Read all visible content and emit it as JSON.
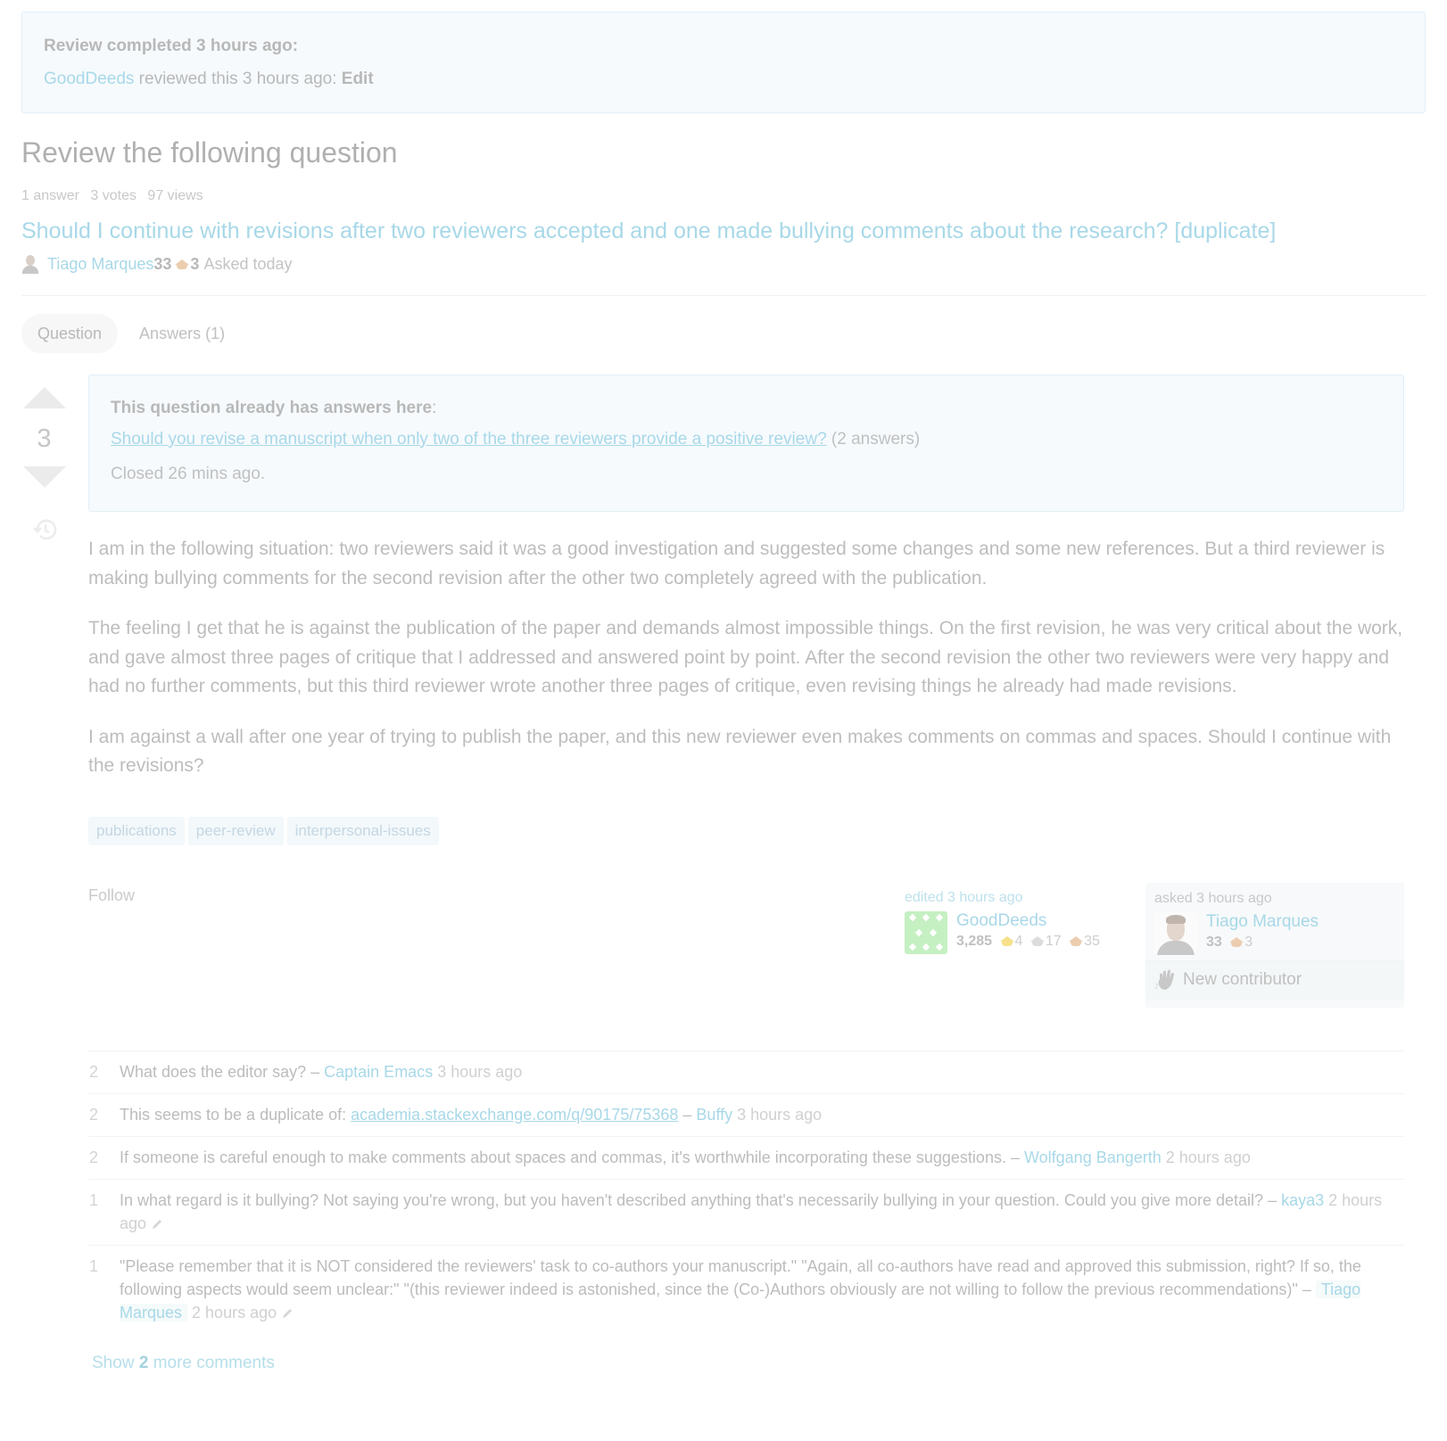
{
  "review_notice": {
    "title": "Review completed 3 hours ago:",
    "reviewer": "GoodDeeds",
    "reviewed_text": " reviewed this 3 hours ago: ",
    "action": "Edit"
  },
  "page_title": "Review the following question",
  "stats": {
    "answers": "1 answer",
    "votes": "3 votes",
    "views": "97 views"
  },
  "question": {
    "title": "Should I continue with revisions after two reviewers accepted and one made bullying comments about the research? [duplicate]",
    "asker": {
      "name": "Tiago Marques",
      "reputation": "33",
      "bronze_badges": "3",
      "asked": "Asked today"
    }
  },
  "tabs": [
    {
      "label": "Question",
      "active": true
    },
    {
      "label": "Answers (1)",
      "active": false
    }
  ],
  "vote_count": "3",
  "duplicate_notice": {
    "heading": "This question already has answers here",
    "colon": ":",
    "link_text": "Should you revise a manuscript when only two of the three reviewers provide a positive review?",
    "link_suffix": " (2 answers)",
    "closed": "Closed 26 mins ago."
  },
  "body": [
    "I am in the following situation: two reviewers said it was a good investigation and suggested some changes and some new references. But a third reviewer is making bullying comments for the second revision after the other two completely agreed with the publication.",
    "The feeling I get that he is against the publication of the paper and demands almost impossible things. On the first revision, he was very critical about the work, and gave almost three pages of critique that I addressed and answered point by point. After the second revision the other two reviewers were very happy and had no further comments, but this third reviewer wrote another three pages of critique, even revising things he already had made revisions.",
    "I am against a wall after one year of trying to publish the paper, and this new reviewer even makes comments on commas and spaces. Should I continue with the revisions?"
  ],
  "tags": [
    "publications",
    "peer-review",
    "interpersonal-issues"
  ],
  "follow_label": "Follow",
  "editor": {
    "action": "edited 3 hours ago",
    "name": "GoodDeeds",
    "reputation": "3,285",
    "gold": "4",
    "silver": "17",
    "bronze": "35"
  },
  "owner": {
    "action": "asked 3 hours ago",
    "name": "Tiago Marques",
    "reputation": "33",
    "bronze": "3",
    "new_contributor": "New contributor"
  },
  "comments": [
    {
      "score": "2",
      "text": "What does the editor say?",
      "sep": " – ",
      "user": "Captain Emacs",
      "date": " 3 hours ago",
      "edited": false
    },
    {
      "score": "2",
      "text": "This seems to be a duplicate of: ",
      "url": "academia.stackexchange.com/q/90175/75368",
      "sep": " – ",
      "user": "Buffy",
      "date": " 3 hours ago",
      "edited": false
    },
    {
      "score": "2",
      "text": "If someone is careful enough to make comments about spaces and commas, it's worthwhile incorporating these suggestions.",
      "sep": " – ",
      "user": "Wolfgang Bangerth",
      "date": " 2 hours ago",
      "edited": false
    },
    {
      "score": "1",
      "text": "In what regard is it bullying? Not saying you're wrong, but you haven't described anything that's necessarily bullying in your question. Could you give more detail?",
      "sep": " – ",
      "user": "kaya3",
      "date": " 2 hours ago",
      "edited": true
    },
    {
      "score": "1",
      "text": "\"Please remember that it is NOT considered the reviewers' task to co-authors your manuscript.\" \"Again, all co-authors have read and approved this submission, right? If so, the following aspects would seem unclear:\" \"(this reviewer indeed is astonished, since the (Co-)Authors obviously are not willing to follow the previous recommendations)\"",
      "sep": " – ",
      "user": "Tiago Marques",
      "date": " 2 hours ago",
      "edited": true,
      "is_op": true
    }
  ],
  "show_more": {
    "prefix": "Show ",
    "count": "2",
    "suffix": " more comments"
  }
}
